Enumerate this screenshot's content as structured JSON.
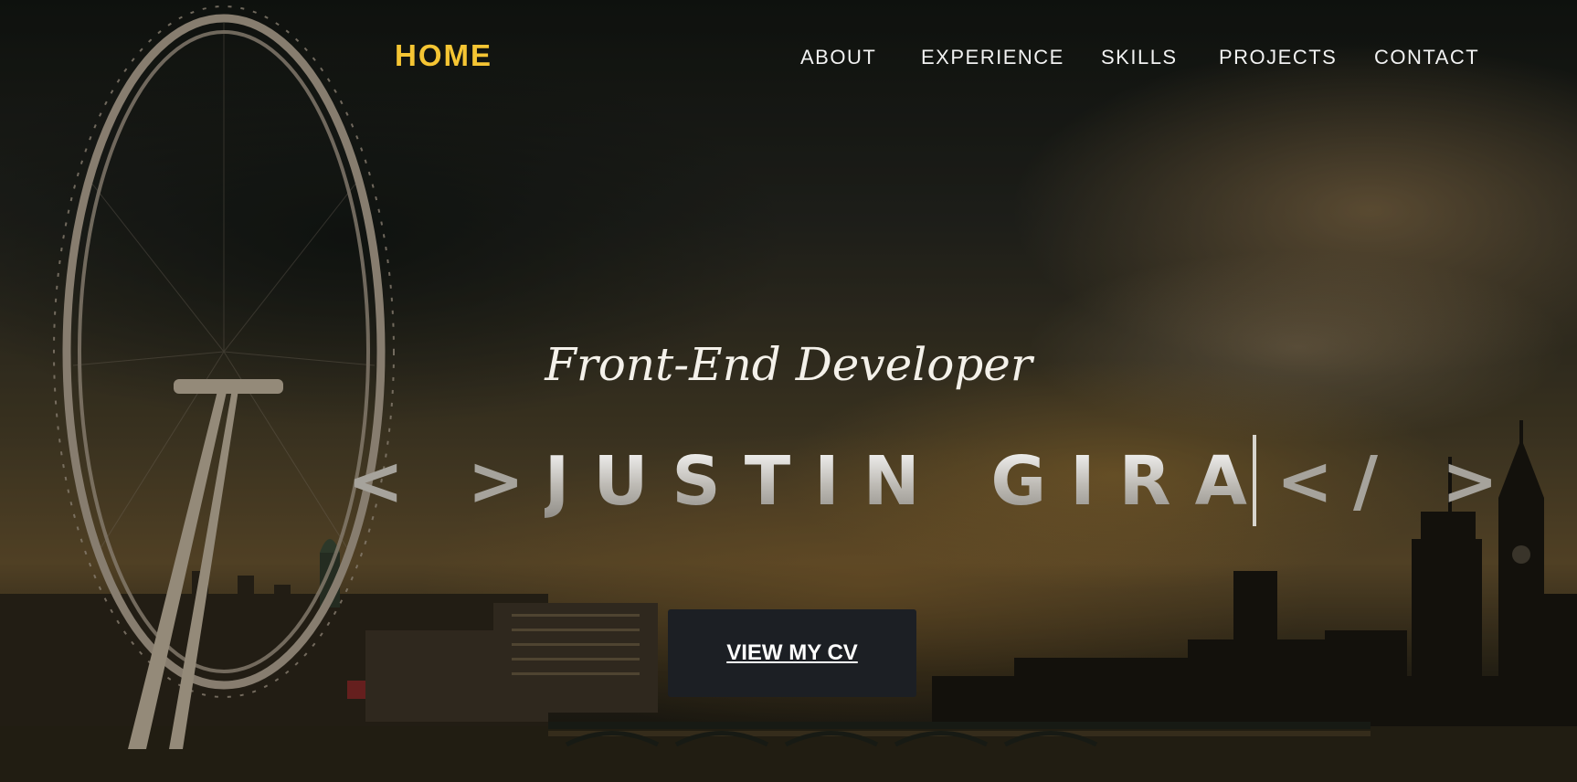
{
  "nav": {
    "home_label": "HOME",
    "items": [
      {
        "label": "ABOUT"
      },
      {
        "label": "EXPERIENCE"
      },
      {
        "label": "SKILLS"
      },
      {
        "label": "PROJECTS"
      },
      {
        "label": "CONTACT"
      }
    ]
  },
  "hero": {
    "subtitle": "Front-End Developer",
    "open_tag": "< >",
    "name": "JUSTIN GIRA",
    "close_tag": "</ >",
    "cta_label": "VIEW MY CV"
  },
  "colors": {
    "accent": "#f5c533",
    "nav_text": "#f2f2f2",
    "button_bg": "#1c1f24"
  }
}
